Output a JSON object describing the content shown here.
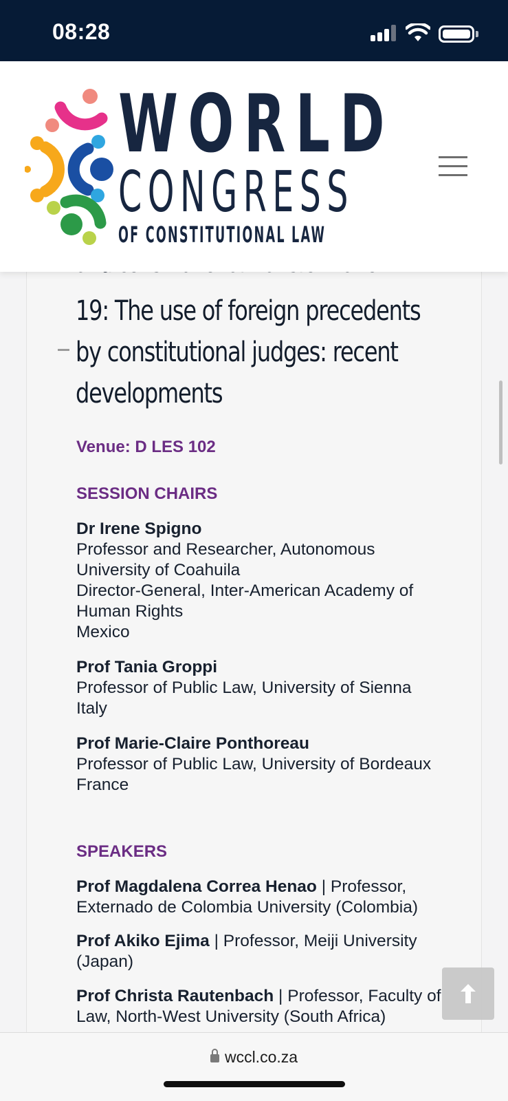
{
  "status_bar": {
    "time": "08:28"
  },
  "header": {
    "logo_line1": "WORLD",
    "logo_line2": "CONGRESS",
    "logo_line3": "OF CONSTITUTIONAL LAW",
    "logo_colors": [
      "#e6318a",
      "#f7a81b",
      "#1a4fa3",
      "#2c9a48",
      "#f08a7f",
      "#2fa6e0",
      "#b9d24a"
    ]
  },
  "session": {
    "heading_clipped": "and constitutional transformation",
    "heading": "19: The use of foreign precedents by constitutional judges: recent developments",
    "venue": "Venue: D LES 102",
    "chairs_label": "SESSION CHAIRS",
    "chairs": [
      {
        "name": "Dr Irene Spigno",
        "lines": [
          "Professor and Researcher, Autonomous University of Coahuila",
          "Director-General, Inter-American Academy of Human Rights",
          "Mexico"
        ]
      },
      {
        "name": "Prof Tania Groppi",
        "lines": [
          "Professor of Public Law, University of Sienna",
          "Italy"
        ]
      },
      {
        "name": "Prof Marie-Claire Ponthoreau",
        "lines": [
          "Professor of Public Law, University of Bordeaux",
          "France"
        ]
      }
    ],
    "speakers_label": "SPEAKERS",
    "speakers": [
      {
        "name": "Prof Magdalena Correa Henao",
        "detail": " | Professor, Externado de Colombia University (Colombia)"
      },
      {
        "name": "Prof Akiko Ejima",
        "detail": " | Professor, Meiji University (Japan)"
      },
      {
        "name": "Prof Christa Rautenbach",
        "detail": " | Professor, Faculty of Law, North-West University (South Africa)"
      }
    ]
  },
  "browser": {
    "url": "wccl.co.za"
  }
}
